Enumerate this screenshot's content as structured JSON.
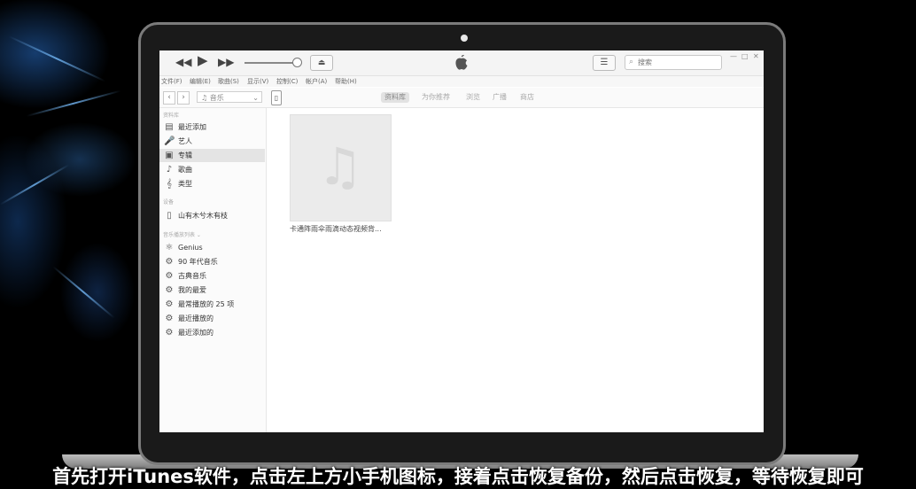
{
  "toolbar": {
    "rewind_icon": "rewind-icon",
    "play_icon": "play-icon",
    "forward_icon": "fast-forward-icon",
    "search_placeholder": "搜索"
  },
  "menu": [
    "文件(F)",
    "编辑(E)",
    "歌曲(S)",
    "显示(V)",
    "控制(C)",
    "帐户(A)",
    "帮助(H)"
  ],
  "navbar": {
    "media_type": "音乐",
    "tabs": [
      {
        "label": "资料库",
        "active": true
      },
      {
        "label": "为你推荐",
        "active": false
      },
      {
        "label": "浏览",
        "active": false
      },
      {
        "label": "广播",
        "active": false
      },
      {
        "label": "商店",
        "active": false
      }
    ]
  },
  "sidebar": {
    "library_header": "资料库",
    "library_items": [
      {
        "label": "最近添加",
        "icon": "recently-added-icon",
        "selected": false
      },
      {
        "label": "艺人",
        "icon": "artist-icon",
        "selected": false
      },
      {
        "label": "专辑",
        "icon": "album-icon",
        "selected": true
      },
      {
        "label": "歌曲",
        "icon": "song-icon",
        "selected": false
      },
      {
        "label": "类型",
        "icon": "genre-icon",
        "selected": false
      }
    ],
    "devices_header": "设备",
    "device_name": "山有木兮木有枝",
    "playlists_header": "音乐播放列表 ⌄",
    "playlists": [
      {
        "label": "Genius",
        "icon": "genius-icon"
      },
      {
        "label": "90 年代音乐",
        "icon": "smart-playlist-gear-icon"
      },
      {
        "label": "古典音乐",
        "icon": "smart-playlist-gear-icon"
      },
      {
        "label": "我的最爱",
        "icon": "smart-playlist-gear-icon"
      },
      {
        "label": "最常播放的 25 项",
        "icon": "smart-playlist-gear-icon"
      },
      {
        "label": "最近播放的",
        "icon": "smart-playlist-gear-icon"
      },
      {
        "label": "最近添加的",
        "icon": "smart-playlist-gear-icon"
      }
    ]
  },
  "content": {
    "album_title": "卡通阵雨伞雨滴动态视频背..."
  },
  "subtitle": "首先打开iTunes软件，点击左上方小手机图标，接着点击恢复备份，然后点击恢复，等待恢复即可"
}
